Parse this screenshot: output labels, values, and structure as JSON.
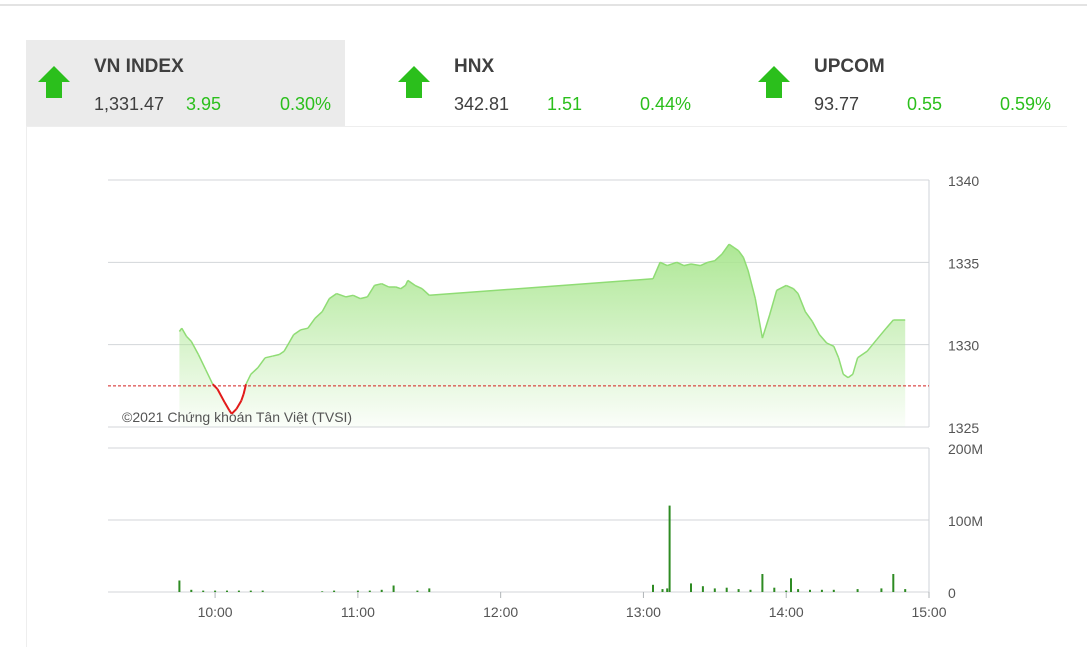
{
  "indices": [
    {
      "name": "VN INDEX",
      "value": "1,331.47",
      "change": "3.95",
      "percent": "0.30%",
      "direction": "up",
      "active": true
    },
    {
      "name": "HNX",
      "value": "342.81",
      "change": "1.51",
      "percent": "0.44%",
      "direction": "up",
      "active": false
    },
    {
      "name": "UPCOM",
      "value": "93.77",
      "change": "0.55",
      "percent": "0.59%",
      "direction": "up",
      "active": false
    }
  ],
  "colors": {
    "up": "#2bbf1c",
    "down": "#e21a1a",
    "area_line": "#8fdc74",
    "area_fill": "#c3efb2",
    "reference": "#d42020",
    "volume": "#2e8b23"
  },
  "chart_data": {
    "type": "area",
    "copyright": "©2021 Chứng khoán Tân Việt (TVSI)",
    "reference_value": 1327.5,
    "price": {
      "ylim": [
        1325,
        1340
      ],
      "yticks": [
        "1340",
        "1335",
        "1330",
        "1325"
      ],
      "points": [
        [
          "09:45",
          1330.8
        ],
        [
          "09:46",
          1331.0
        ],
        [
          "09:48",
          1330.5
        ],
        [
          "09:50",
          1330.2
        ],
        [
          "09:53",
          1329.4
        ],
        [
          "09:56",
          1328.5
        ],
        [
          "09:59",
          1327.6
        ],
        [
          "10:01",
          1327.3
        ],
        [
          "10:04",
          1326.5
        ],
        [
          "10:06",
          1326.0
        ],
        [
          "10:07",
          1325.8
        ],
        [
          "10:09",
          1326.1
        ],
        [
          "10:11",
          1326.6
        ],
        [
          "10:12",
          1327.0
        ],
        [
          "10:13",
          1327.6
        ],
        [
          "10:15",
          1328.2
        ],
        [
          "10:18",
          1328.6
        ],
        [
          "10:21",
          1329.2
        ],
        [
          "10:24",
          1329.3
        ],
        [
          "10:27",
          1329.4
        ],
        [
          "10:29",
          1329.6
        ],
        [
          "10:31",
          1330.1
        ],
        [
          "10:33",
          1330.6
        ],
        [
          "10:36",
          1330.9
        ],
        [
          "10:39",
          1331.0
        ],
        [
          "10:42",
          1331.6
        ],
        [
          "10:45",
          1332.0
        ],
        [
          "10:48",
          1332.8
        ],
        [
          "10:51",
          1333.1
        ],
        [
          "10:55",
          1332.9
        ],
        [
          "10:58",
          1333.0
        ],
        [
          "11:01",
          1332.8
        ],
        [
          "11:04",
          1332.9
        ],
        [
          "11:07",
          1333.6
        ],
        [
          "11:10",
          1333.7
        ],
        [
          "11:13",
          1333.5
        ],
        [
          "11:16",
          1333.5
        ],
        [
          "11:18",
          1333.4
        ],
        [
          "11:20",
          1333.6
        ],
        [
          "11:21",
          1333.9
        ],
        [
          "11:24",
          1333.6
        ],
        [
          "11:27",
          1333.4
        ],
        [
          "11:30",
          1333.0
        ],
        [
          "13:04",
          1334.0
        ],
        [
          "13:07",
          1335.0
        ],
        [
          "13:10",
          1334.8
        ],
        [
          "13:14",
          1335.0
        ],
        [
          "13:17",
          1334.8
        ],
        [
          "13:20",
          1334.9
        ],
        [
          "13:24",
          1334.8
        ],
        [
          "13:27",
          1335.0
        ],
        [
          "13:30",
          1335.1
        ],
        [
          "13:33",
          1335.5
        ],
        [
          "13:36",
          1336.1
        ],
        [
          "13:38",
          1335.9
        ],
        [
          "13:40",
          1335.7
        ],
        [
          "13:42",
          1335.3
        ],
        [
          "13:44",
          1334.5
        ],
        [
          "13:47",
          1332.8
        ],
        [
          "13:50",
          1330.4
        ],
        [
          "13:53",
          1331.8
        ],
        [
          "13:56",
          1333.3
        ],
        [
          "14:00",
          1333.6
        ],
        [
          "14:03",
          1333.4
        ],
        [
          "14:05",
          1333.1
        ],
        [
          "14:08",
          1332.0
        ],
        [
          "14:11",
          1331.4
        ],
        [
          "14:14",
          1330.6
        ],
        [
          "14:17",
          1330.1
        ],
        [
          "14:20",
          1329.9
        ],
        [
          "14:22",
          1329.2
        ],
        [
          "14:24",
          1328.2
        ],
        [
          "14:26",
          1328.0
        ],
        [
          "14:28",
          1328.2
        ],
        [
          "14:30",
          1329.2
        ],
        [
          "14:34",
          1329.6
        ],
        [
          "14:38",
          1330.3
        ],
        [
          "14:42",
          1331.0
        ],
        [
          "14:45",
          1331.5
        ],
        [
          "14:50",
          1331.5
        ]
      ]
    },
    "volume": {
      "ylim": [
        0,
        200
      ],
      "yticks": [
        "200M",
        "100M",
        "0"
      ],
      "bars": [
        [
          "09:45",
          16
        ],
        [
          "09:50",
          3
        ],
        [
          "09:55",
          2
        ],
        [
          "10:00",
          2
        ],
        [
          "10:05",
          2
        ],
        [
          "10:10",
          2
        ],
        [
          "10:15",
          2
        ],
        [
          "10:20",
          2
        ],
        [
          "10:45",
          1
        ],
        [
          "10:50",
          2
        ],
        [
          "11:00",
          2
        ],
        [
          "11:05",
          2
        ],
        [
          "11:10",
          3
        ],
        [
          "11:15",
          9
        ],
        [
          "11:25",
          2
        ],
        [
          "11:30",
          5
        ],
        [
          "13:04",
          10
        ],
        [
          "13:08",
          4
        ],
        [
          "13:10",
          5
        ],
        [
          "13:11",
          120
        ],
        [
          "13:20",
          12
        ],
        [
          "13:25",
          8
        ],
        [
          "13:30",
          5
        ],
        [
          "13:35",
          6
        ],
        [
          "13:40",
          4
        ],
        [
          "13:45",
          3
        ],
        [
          "13:50",
          25
        ],
        [
          "13:55",
          6
        ],
        [
          "14:00",
          2
        ],
        [
          "14:02",
          19
        ],
        [
          "14:05",
          4
        ],
        [
          "14:10",
          3
        ],
        [
          "14:15",
          3
        ],
        [
          "14:20",
          3
        ],
        [
          "14:30",
          4
        ],
        [
          "14:40",
          5
        ],
        [
          "14:45",
          25
        ],
        [
          "14:50",
          4
        ]
      ]
    },
    "xticks": [
      "10:00",
      "11:00",
      "12:00",
      "13:00",
      "14:00",
      "15:00"
    ]
  }
}
